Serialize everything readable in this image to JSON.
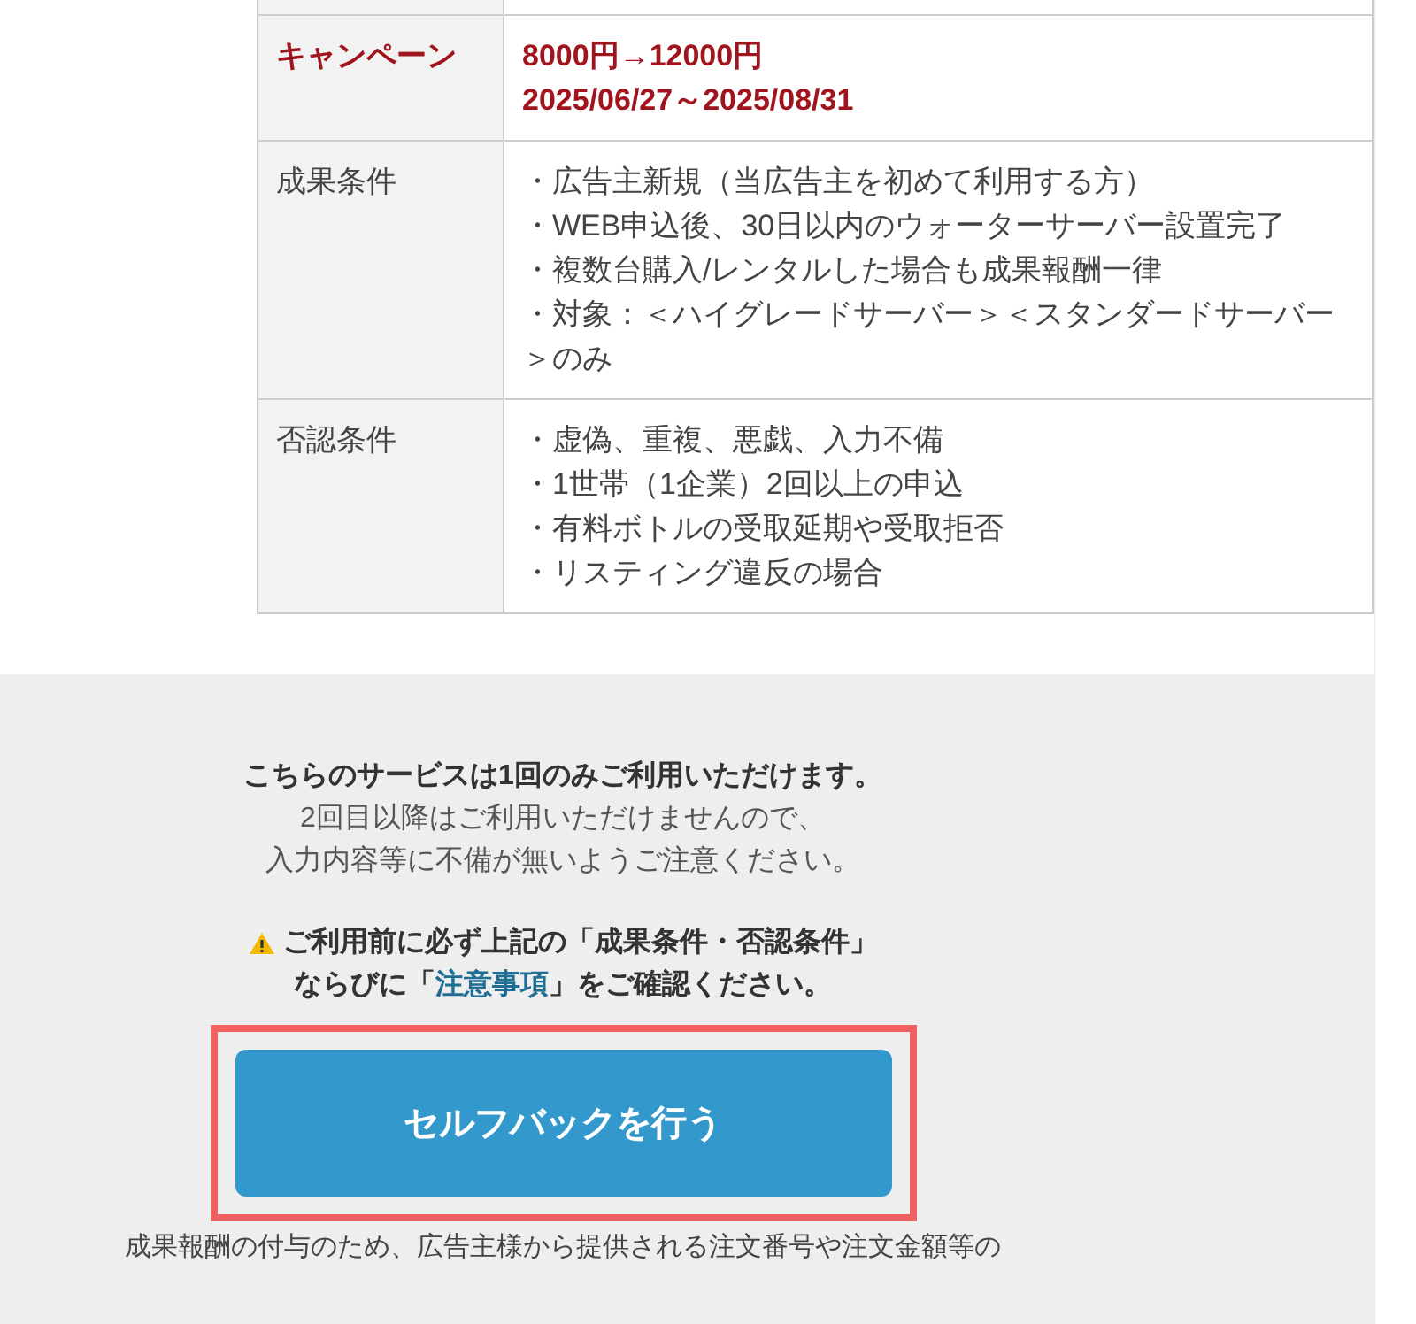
{
  "table": {
    "rows": [
      {
        "kind": "blank",
        "label": "",
        "values": []
      },
      {
        "kind": "highlight",
        "label": "キャンペーン",
        "values": [
          "8000円→12000円",
          "2025/06/27～2025/08/31"
        ]
      },
      {
        "kind": "list",
        "label": "成果条件",
        "values": [
          "・広告主新規（当広告主を初めて利用する方）",
          "・WEB申込後、30日以内のウォーターサーバー設置完了",
          "・複数台購入/レンタルした場合も成果報酬一律",
          "・対象：＜ハイグレードサーバー＞＜スタンダードサーバー＞のみ"
        ]
      },
      {
        "kind": "list",
        "label": "否認条件",
        "values": [
          "・虚偽、重複、悪戯、入力不備",
          "・1世帯（1企業）2回以上の申込",
          "・有料ボトルの受取延期や受取拒否",
          "・リスティング違反の場合"
        ]
      }
    ]
  },
  "notice": {
    "heading": "こちらのサービスは1回のみご利用いただけます。",
    "lines": [
      "2回目以降はご利用いただけませんので、",
      "入力内容等に不備が無いようご注意ください。"
    ]
  },
  "warning": {
    "line_1": "ご利用前に必ず上記の「成果条件・否認条件」",
    "line_2_before": "ならびに「",
    "link": "注意事項",
    "line_2_after": "」をご確認ください。"
  },
  "button": {
    "label": "セルフバックを行う",
    "highlighted": true
  },
  "footnote": "成果報酬の付与のため、広告主様から提供される注文番号や注文金額等の"
}
